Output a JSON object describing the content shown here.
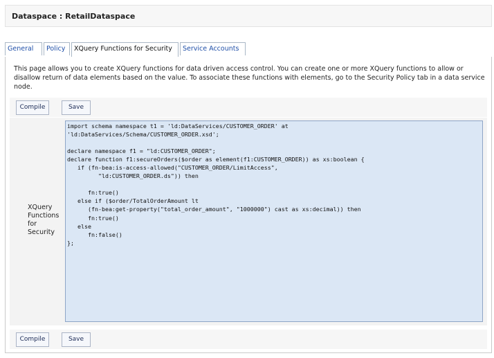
{
  "header": {
    "title": "Dataspace : RetailDataspace"
  },
  "tabs": [
    {
      "label": "General",
      "active": false
    },
    {
      "label": "Policy",
      "active": false
    },
    {
      "label": "XQuery Functions for Security",
      "active": true
    },
    {
      "label": "Service Accounts",
      "active": false
    }
  ],
  "description": "This page allows you to create XQuery functions for data driven access control. You can create one or more XQuery functions to allow or disallow return of data elements based on the value. To associate these functions with elements, go to the Security Policy tab in a data service node.",
  "toolbar_top": {
    "compile_label": "Compile",
    "save_label": "Save"
  },
  "toolbar_bottom": {
    "compile_label": "Compile",
    "save_label": "Save"
  },
  "form": {
    "field_label": "XQuery Functions for Security",
    "code": "import schema namespace t1 = 'ld:DataServices/CUSTOMER_ORDER' at\n'ld:DataServices/Schema/CUSTOMER_ORDER.xsd';\n\ndeclare namespace f1 = \"ld:CUSTOMER_ORDER\";\ndeclare function f1:secureOrders($order as element(f1:CUSTOMER_ORDER)) as xs:boolean {\n   if (fn-bea:is-access-allowed(\"CUSTOMER_ORDER/LimitAccess\",\n         \"ld:CUSTOMER_ORDER.ds\")) then\n\n      fn:true()\n   else if ($order/TotalOrderAmount lt\n      (fn-bea:get-property(\"total_order_amount\", \"1000000\") cast as xs:decimal)) then\n      fn:true()\n   else\n      fn:false()\n};"
  }
}
